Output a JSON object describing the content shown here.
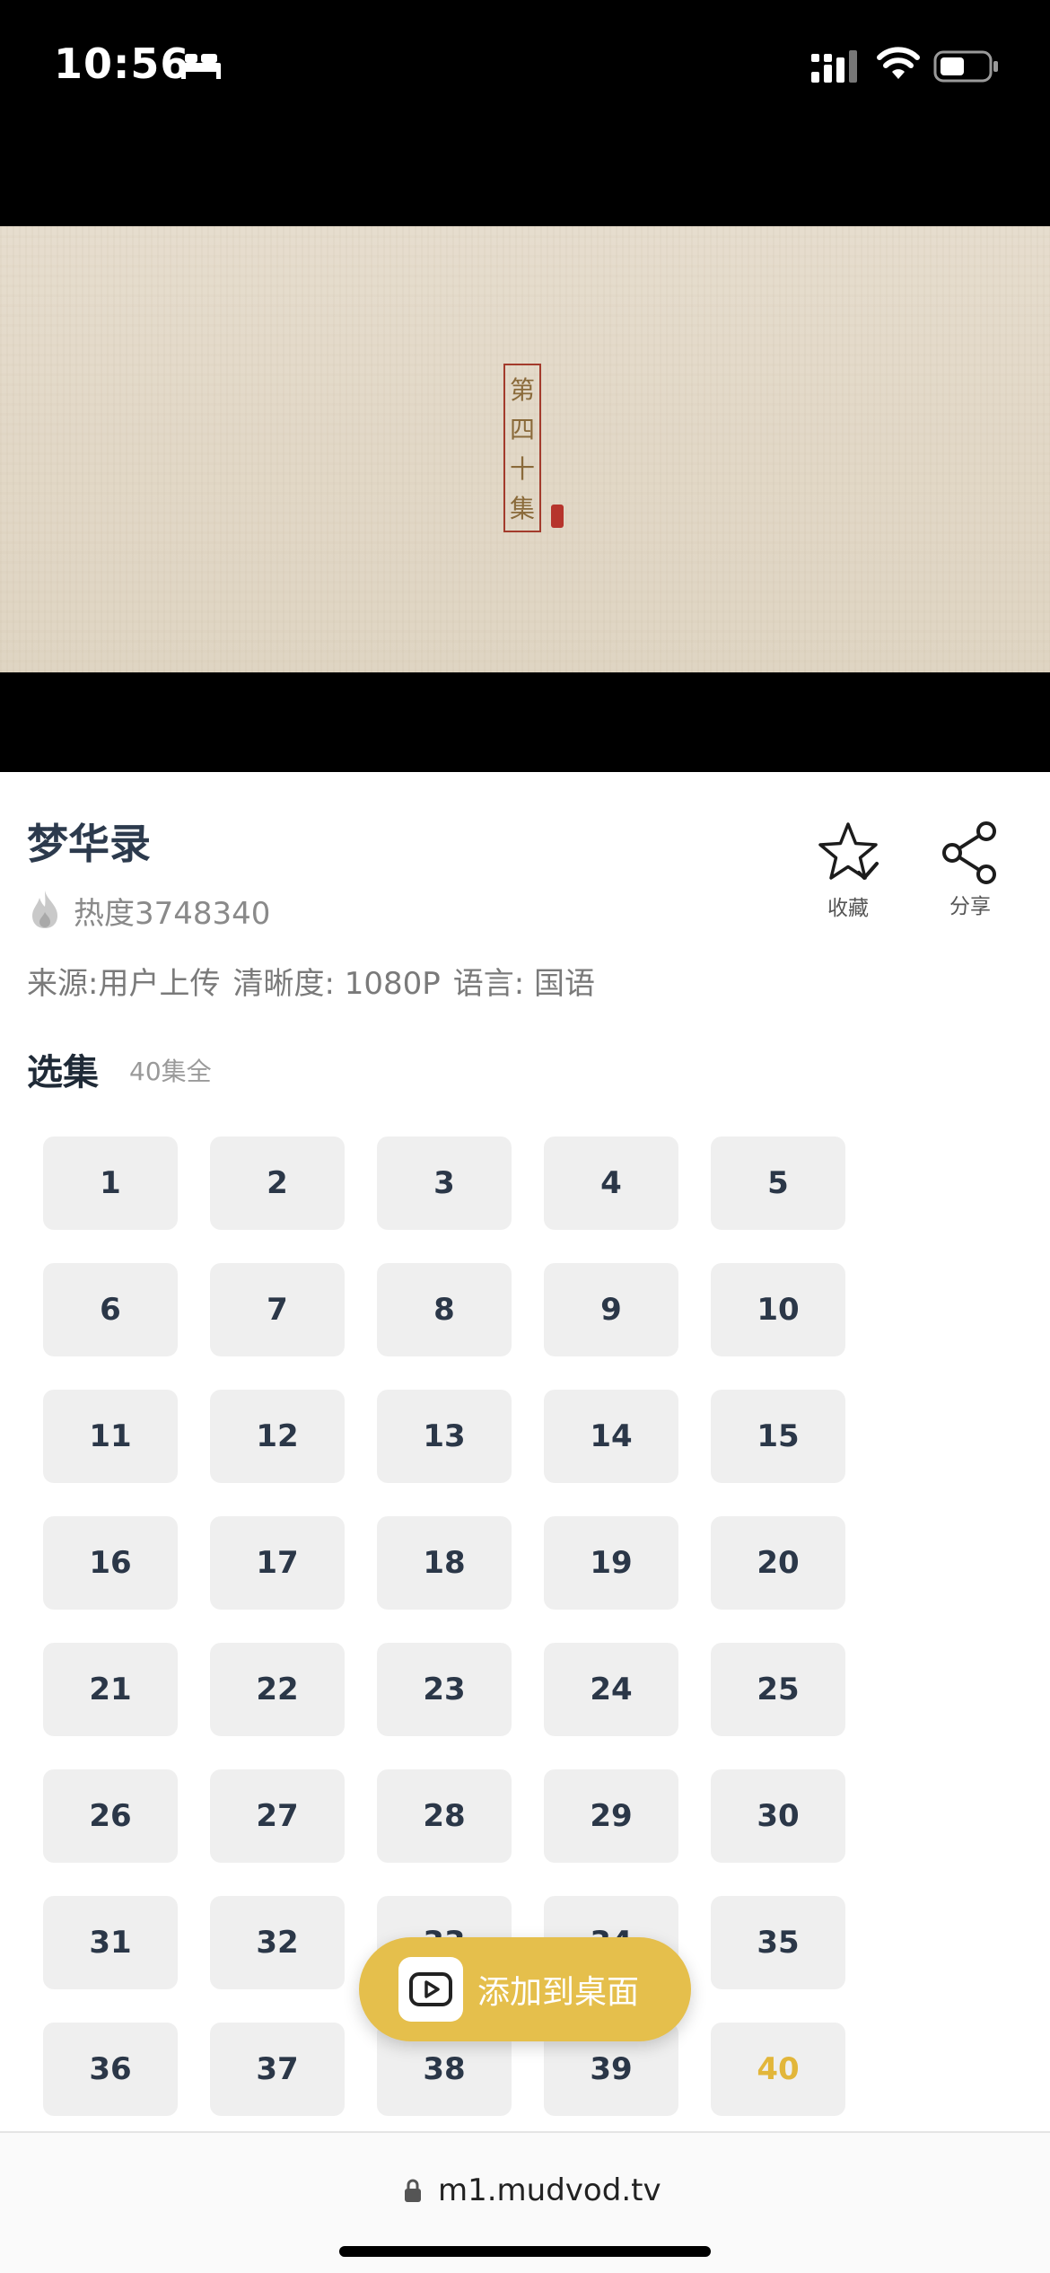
{
  "status_bar": {
    "time": "10:56",
    "icons": [
      "bed-icon",
      "signal-icon",
      "wifi-icon",
      "battery-icon"
    ]
  },
  "video": {
    "seal_text": "第四十集"
  },
  "show": {
    "title": "梦华录",
    "heat": "热度3748340",
    "favorite_label": "收藏",
    "share_label": "分享",
    "source": "来源:用户上传",
    "clarity": "清晰度: 1080P",
    "language": "语言: 国语"
  },
  "episodes": {
    "section_title": "选集",
    "count_label": "40集全",
    "current": "40",
    "list": [
      "1",
      "2",
      "3",
      "4",
      "5",
      "6",
      "7",
      "8",
      "9",
      "10",
      "11",
      "12",
      "13",
      "14",
      "15",
      "16",
      "17",
      "18",
      "19",
      "20",
      "21",
      "22",
      "23",
      "24",
      "25",
      "26",
      "27",
      "28",
      "29",
      "30",
      "31",
      "32",
      "33",
      "34",
      "35",
      "36",
      "37",
      "38",
      "39",
      "40"
    ]
  },
  "floating_button": {
    "label": "添加到桌面"
  },
  "url_bar": {
    "url": "m1.mudvod.tv"
  },
  "colors": {
    "accent": "#e5bf4c",
    "active_episode": "#e2b63a",
    "title": "#2c3a4d"
  }
}
